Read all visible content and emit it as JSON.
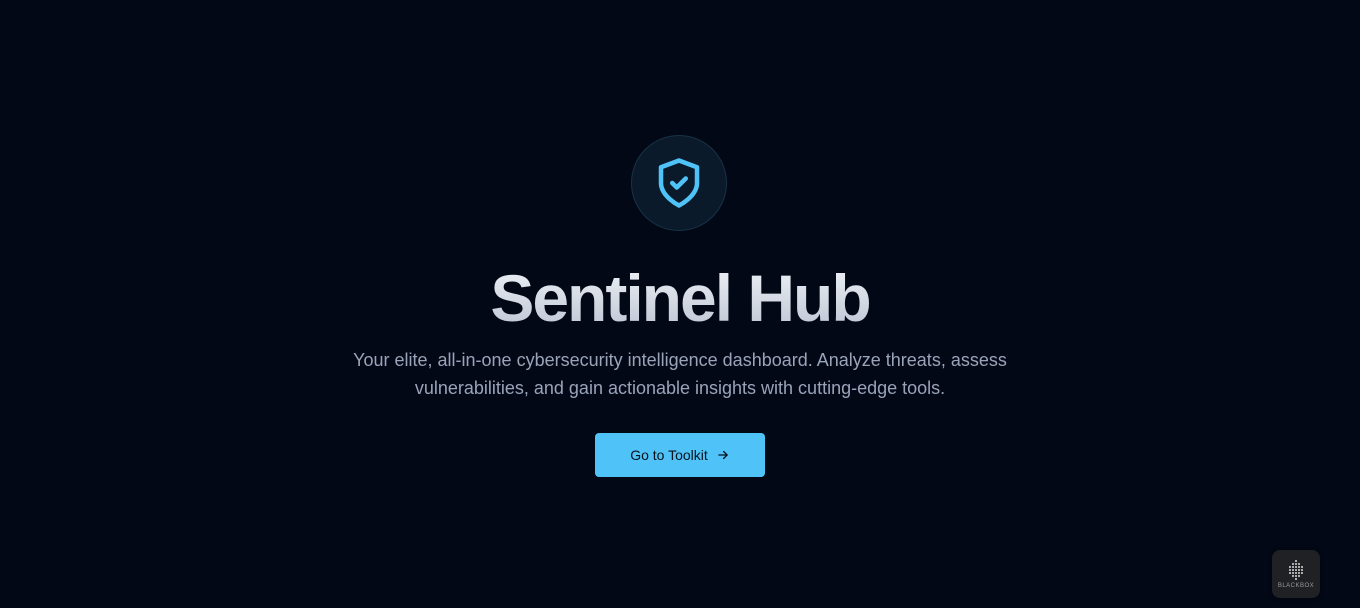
{
  "hero": {
    "icon": "shield-check-icon",
    "title": "Sentinel Hub",
    "subtitle": "Your elite, all-in-one cybersecurity intelligence dashboard. Analyze threats, assess vulnerabilities, and gain actionable insights with cutting-edge tools.",
    "cta_label": "Go to Toolkit",
    "cta_icon": "arrow-right-icon"
  },
  "badge": {
    "icon": "blackbox-logo-icon",
    "label": "BLACKBOX"
  },
  "colors": {
    "background": "#030817",
    "accent": "#4fc3f7",
    "icon_circle": "#0b1a2a",
    "subtitle_text": "#9aa4b8"
  }
}
